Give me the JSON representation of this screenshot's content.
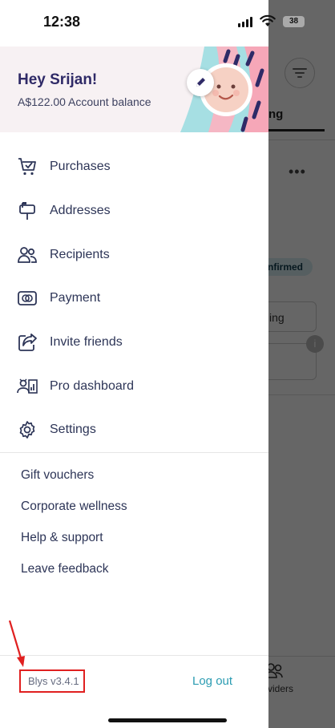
{
  "status_bar": {
    "time": "12:38",
    "battery": "38"
  },
  "header": {
    "greeting": "Hey Srijan!",
    "balance": "A$122.00 Account balance"
  },
  "menu": [
    {
      "label": "Purchases",
      "icon": "cart-icon"
    },
    {
      "label": "Addresses",
      "icon": "mailbox-icon"
    },
    {
      "label": "Recipients",
      "icon": "people-icon"
    },
    {
      "label": "Payment",
      "icon": "card-icon"
    },
    {
      "label": "Invite friends",
      "icon": "share-icon"
    },
    {
      "label": "Pro dashboard",
      "icon": "dashboard-icon"
    },
    {
      "label": "Settings",
      "icon": "gear-icon"
    }
  ],
  "links": [
    "Gift vouchers",
    "Corporate wellness",
    "Help & support",
    "Leave feedback"
  ],
  "footer": {
    "version": "Blys v3.4.1",
    "logout": "Log out"
  },
  "background": {
    "tab": "ng",
    "badge": "nfirmed",
    "card": "ing",
    "nav": "viders",
    "badge_info": "i"
  },
  "colors": {
    "accent": "#2b9cb2",
    "brand": "#2f2a67",
    "annotation": "#e02020"
  }
}
